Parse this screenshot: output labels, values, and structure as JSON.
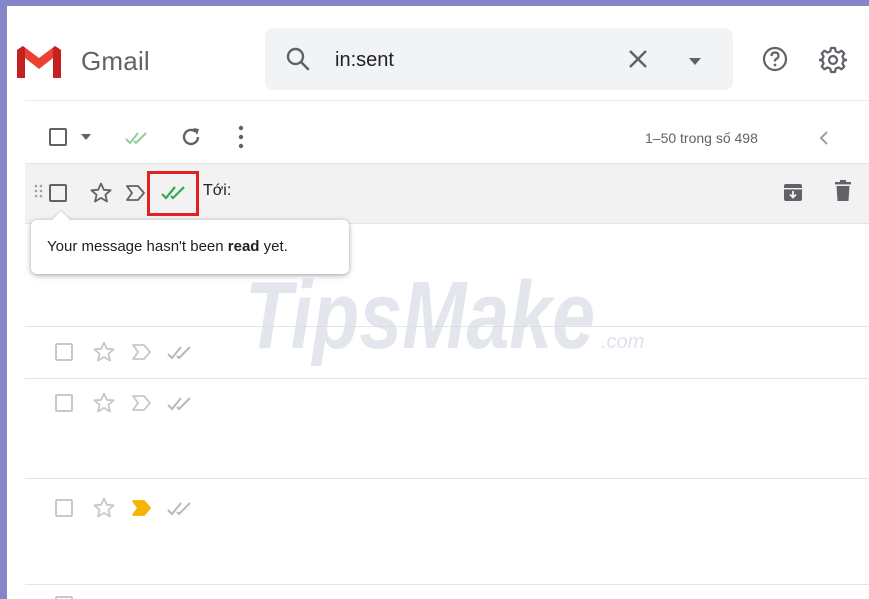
{
  "header": {
    "brand": "Gmail",
    "search_value": "in:sent",
    "icons": [
      "gmail-logo",
      "search-icon",
      "close-icon",
      "dropdown-icon",
      "help-icon",
      "gear-icon"
    ]
  },
  "toolbar": {
    "pagination": "1–50 trong số 498",
    "icons": [
      "select-checkbox",
      "caret-down-icon",
      "double-check-icon",
      "refresh-icon",
      "more-vert-icon",
      "chevron-left-icon"
    ]
  },
  "email_rows": [
    {
      "recipient_label": "Tới:",
      "hovered": true,
      "double_check_color": "#34a853",
      "important": false
    },
    {
      "recipient_label": "",
      "hovered": false,
      "important": false
    },
    {
      "recipient_label": "",
      "hovered": false,
      "important": false
    },
    {
      "recipient_label": "",
      "hovered": false,
      "important": true,
      "important_color": "#f4b400"
    }
  ],
  "tooltip": {
    "prefix": "Your message hasn't been ",
    "emphasis": "read",
    "suffix": " yet."
  },
  "watermark": {
    "main": "TipsMake",
    "suffix": ".com"
  },
  "colors": {
    "frame": "#8585c8",
    "gmail_red": "#ea4335",
    "check_green": "#34a853",
    "highlight_red": "#e02222",
    "important_yellow": "#f4b400"
  }
}
